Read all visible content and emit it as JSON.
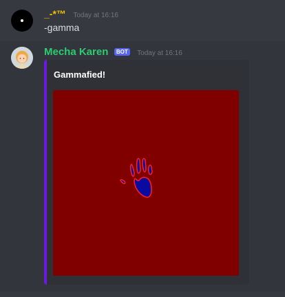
{
  "messages": [
    {
      "author": "_-*™",
      "author_color": "#f5c400",
      "timestamp": "Today at 16:16",
      "content": "-gamma"
    },
    {
      "author": "Mecha Karen",
      "author_color": "#2ecc71",
      "bot_tag": "BOT",
      "timestamp": "Today at 16:16",
      "embed": {
        "title": "Gammafied!",
        "accent_color": "#6b1ae6",
        "image_background": "#800000",
        "image_icon": "handprint-icon"
      }
    }
  ]
}
